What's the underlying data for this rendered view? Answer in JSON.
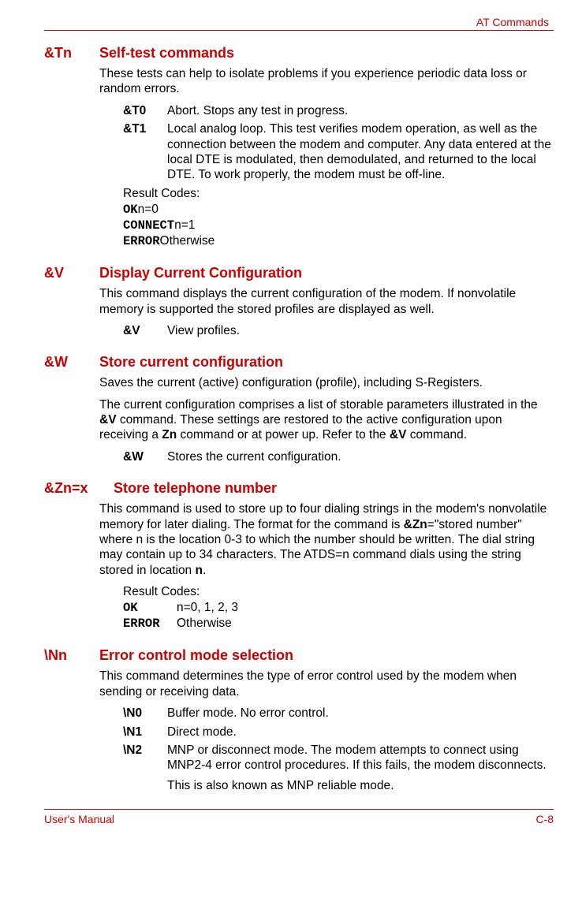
{
  "header": {
    "category": "AT Commands"
  },
  "sections": {
    "tn": {
      "cmd": "&Tn",
      "title": "Self-test commands",
      "intro": "These tests can help to isolate problems if you experience periodic data loss or random errors.",
      "items": [
        {
          "key": "&T0",
          "desc": "Abort. Stops any test in progress."
        },
        {
          "key": "&T1",
          "desc": "Local analog loop. This test verifies modem operation, as well as the connection between the modem and computer. Any data entered at the local DTE is modulated, then demodulated, and returned to the local DTE. To work properly, the modem must be off-line."
        }
      ],
      "result_label": "Result Codes:",
      "result_lines": {
        "l1_code": "OK",
        "l1_rest": "n=0",
        "l2_code": "CONNECT",
        "l2_rest": "n=1",
        "l3_code": "ERROR",
        "l3_rest": "Otherwise"
      }
    },
    "v": {
      "cmd": "&V",
      "title": "Display Current Configuration",
      "intro": "This command displays the current configuration of the modem. If nonvolatile memory is supported the stored profiles are displayed as well.",
      "items": [
        {
          "key": "&V",
          "desc": "View profiles."
        }
      ]
    },
    "w": {
      "cmd": "&W",
      "title": "Store current configuration",
      "intro1": "Saves the current (active) configuration (profile), including S-Registers.",
      "intro2_a": "The current configuration comprises a list of storable parameters illustrated in the ",
      "intro2_b": "&V",
      "intro2_c": " command. These settings are restored to the active configuration upon receiving a ",
      "intro2_d": "Zn",
      "intro2_e": " command or at power up. Refer to the ",
      "intro2_f": "&V",
      "intro2_g": " command.",
      "items": [
        {
          "key": "&W",
          "desc": "Stores the current configuration."
        }
      ]
    },
    "zn": {
      "cmd": "&Zn=x",
      "title": "Store telephone number",
      "intro_a": "This command is used to store up to four dialing strings in the modem's nonvolatile memory for later dialing. The format for the command is ",
      "intro_b": "&Zn",
      "intro_c": "=\"stored number\" where n is the location 0-3 to which the number should be written. The dial string may contain up to 34 characters. The ATDS=n command dials using the string stored in location ",
      "intro_d": "n",
      "intro_e": ".",
      "result_label": "Result Codes:",
      "r1_code": "OK",
      "r1_rest": "n=0, 1, 2, 3",
      "r2_code": "ERROR",
      "r2_rest": "Otherwise"
    },
    "nn": {
      "cmd": "\\Nn",
      "title": "Error control mode selection",
      "intro": "This command determines the type of error control used by the modem when sending or receiving data.",
      "items": [
        {
          "key": "\\N0",
          "desc": "Buffer mode. No error control."
        },
        {
          "key": "\\N1",
          "desc": "Direct mode."
        },
        {
          "key": "\\N2",
          "desc": "MNP or disconnect mode. The modem attempts to connect using MNP2-4 error control procedures. If this fails, the modem disconnects.",
          "extra": "This is also known as MNP reliable mode."
        }
      ]
    }
  },
  "footer": {
    "left": "User's Manual",
    "right": "C-8"
  }
}
